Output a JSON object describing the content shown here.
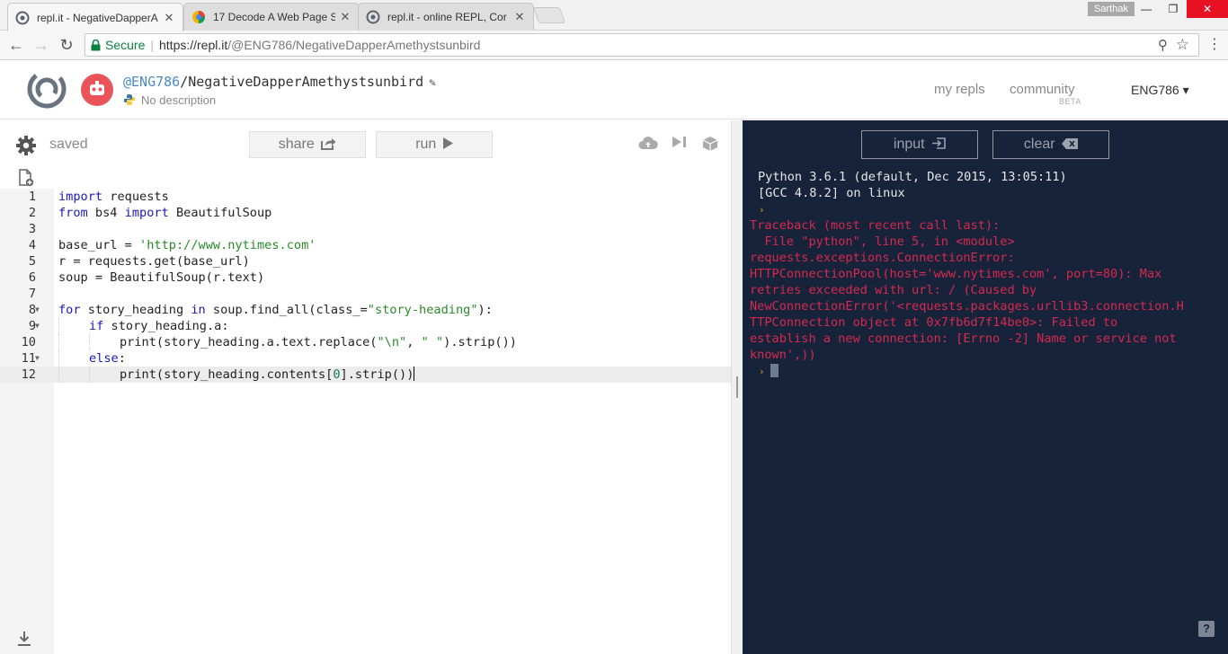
{
  "browser": {
    "tabs": [
      {
        "title": "repl.it - NegativeDapperA",
        "icon": "replit-icon",
        "active": true
      },
      {
        "title": "17 Decode A Web Page S",
        "icon": "chrome-colors-icon",
        "active": false
      },
      {
        "title": "repl.it - online REPL, Cor",
        "icon": "replit-icon",
        "active": false
      }
    ],
    "close_glyph": "✕",
    "profile_name": "Sarthak",
    "secure_label": "Secure",
    "url_host": "https://repl.it",
    "url_path": "/@ENG786/NegativeDapperAmethystsunbird",
    "colors": {
      "secure": "#0b8043",
      "close_button": "#e81123"
    }
  },
  "repl": {
    "owner": "@ENG786",
    "slash": "/",
    "name": "NegativeDapperAmethystsunbird",
    "description": "No description",
    "nav": {
      "my_repls": "my repls",
      "community": "community",
      "community_badge": "BETA",
      "user": "ENG786 ▾"
    }
  },
  "editor": {
    "status": "saved",
    "share_label": "share",
    "run_label": "run",
    "lines": [
      {
        "n": "1"
      },
      {
        "n": "2"
      },
      {
        "n": "3"
      },
      {
        "n": "4"
      },
      {
        "n": "5"
      },
      {
        "n": "6"
      },
      {
        "n": "7"
      },
      {
        "n": "8"
      },
      {
        "n": "9"
      },
      {
        "n": "10"
      },
      {
        "n": "11"
      },
      {
        "n": "12"
      }
    ],
    "code": {
      "l1_kw": "import",
      "l1_rest": " requests",
      "l2_kw1": "from",
      "l2_mid": " bs4 ",
      "l2_kw2": "import",
      "l2_rest": " BeautifulSoup",
      "l4_a": "base_url = ",
      "l4_str": "'http://www.nytimes.com'",
      "l5": "r = requests.get(base_url)",
      "l6": "soup = BeautifulSoup(r.text)",
      "l8_kw1": "for",
      "l8_a": " story_heading ",
      "l8_kw2": "in",
      "l8_b": " soup.find_all(class_=",
      "l8_str": "\"story-heading\"",
      "l8_c": "):",
      "l9_kw": "if",
      "l9_rest": " story_heading.a:",
      "l10_a": "print(story_heading.a.text.replace(",
      "l10_str1": "\"\\n\"",
      "l10_b": ", ",
      "l10_str2": "\" \"",
      "l10_c": ").strip())",
      "l11_kw": "else",
      "l11_rest": ":",
      "l12_a": "print(story_heading.contents[",
      "l12_num": "0",
      "l12_b": "].strip())"
    }
  },
  "console": {
    "input_label": "input",
    "clear_label": "clear",
    "header_lines": [
      "Python 3.6.1 (default, Dec 2015, 13:05:11)",
      "[GCC 4.8.2] on linux"
    ],
    "prompt_glyph": "›",
    "error_lines": [
      "Traceback (most recent call last):",
      "  File \"python\", line 5, in <module>",
      "requests.exceptions.ConnectionError:",
      "HTTPConnectionPool(host='www.nytimes.com', port=80): Max",
      "retries exceeded with url: / (Caused by",
      "NewConnectionError('<requests.packages.urllib3.connection.H",
      "TTPConnection object at 0x7fb6d7f14be0>: Failed to",
      "establish a new connection: [Errno -2] Name or service not",
      "known',))"
    ],
    "help_label": "?",
    "colors": {
      "background": "#16233a",
      "error": "#d6294d",
      "prompt": "#d9a31a"
    }
  }
}
